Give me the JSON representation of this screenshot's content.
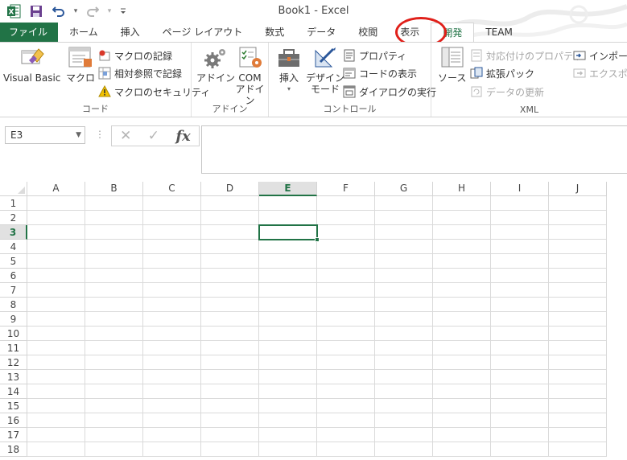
{
  "title_bar": {
    "app_title": "Book1 - Excel"
  },
  "quick_access": [
    {
      "name": "excel-logo-icon",
      "glyph": "X"
    },
    {
      "name": "save-icon",
      "glyph": "💾"
    },
    {
      "name": "undo-icon",
      "glyph": "↶"
    },
    {
      "name": "undo-dropdown-icon",
      "glyph": "▾"
    },
    {
      "name": "redo-icon",
      "glyph": "↷"
    },
    {
      "name": "redo-dropdown-icon",
      "glyph": "▾"
    },
    {
      "name": "customize-qat-icon",
      "glyph": "⌄"
    }
  ],
  "tabs": [
    {
      "id": "file",
      "label": "ファイル"
    },
    {
      "id": "home",
      "label": "ホーム"
    },
    {
      "id": "insert",
      "label": "挿入"
    },
    {
      "id": "page-layout",
      "label": "ページ レイアウト"
    },
    {
      "id": "formulas",
      "label": "数式"
    },
    {
      "id": "data",
      "label": "データ"
    },
    {
      "id": "review",
      "label": "校閲"
    },
    {
      "id": "view",
      "label": "表示"
    },
    {
      "id": "developer",
      "label": "開発"
    },
    {
      "id": "team",
      "label": "TEAM"
    }
  ],
  "ribbon": {
    "code": {
      "label": "コード",
      "visual_basic": "Visual Basic",
      "macros": "マクロ",
      "record_macro": "マクロの記録",
      "relative_refs": "相対参照で記録",
      "macro_security": "マクロのセキュリティ"
    },
    "addins": {
      "label": "アドイン",
      "addins_btn": "アドイン",
      "com_line1": "COM",
      "com_line2": "アドイン"
    },
    "controls": {
      "label": "コントロール",
      "insert_btn": "挿入",
      "design_line1": "デザイン",
      "design_line2": "モード",
      "properties": "プロパティ",
      "view_code": "コードの表示",
      "run_dialog": "ダイアログの実行"
    },
    "xml": {
      "label": "XML",
      "source_btn": "ソース",
      "map_properties": "対応付けのプロパティ",
      "expansion_packs": "拡張パック",
      "refresh_data": "データの更新",
      "import": "インポート",
      "export": "エクスポー"
    }
  },
  "formula_bar": {
    "name_box": "E3",
    "cancel_glyph": "✕",
    "enter_glyph": "✓",
    "fx_glyph": "fx",
    "formula": ""
  },
  "grid": {
    "columns": [
      "A",
      "B",
      "C",
      "D",
      "E",
      "F",
      "G",
      "H",
      "I",
      "J"
    ],
    "rows": [
      "1",
      "2",
      "3",
      "4",
      "5",
      "6",
      "7",
      "8",
      "9",
      "10",
      "11",
      "12",
      "13",
      "14",
      "15",
      "16",
      "17",
      "18"
    ],
    "active_column": "E",
    "active_row": "3"
  },
  "colors": {
    "excel_green": "#217346",
    "highlight_red": "#e0201a"
  }
}
